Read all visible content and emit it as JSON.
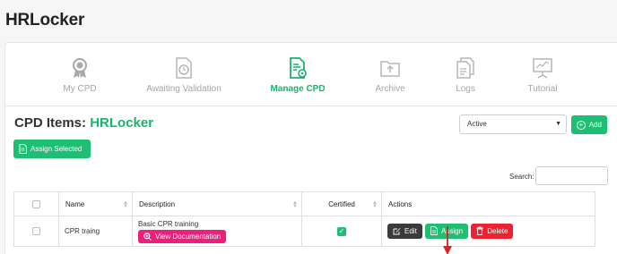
{
  "app": {
    "title": "HRLocker"
  },
  "nav": [
    {
      "label": "My CPD",
      "icon": "medal-icon",
      "active": false
    },
    {
      "label": "Awaiting Validation",
      "icon": "document-clock-icon",
      "active": false
    },
    {
      "label": "Manage CPD",
      "icon": "document-settings-icon",
      "active": true
    },
    {
      "label": "Archive",
      "icon": "archive-folder-icon",
      "active": false
    },
    {
      "label": "Logs",
      "icon": "files-icon",
      "active": false
    },
    {
      "label": "Tutorial",
      "icon": "presentation-board-icon",
      "active": false
    }
  ],
  "section": {
    "title_prefix": "CPD Items:",
    "title_brand": "HRLocker"
  },
  "filter": {
    "selected": "Active"
  },
  "buttons": {
    "add": "Add",
    "assign_selected": "Assign Selected"
  },
  "search": {
    "label": "Search:",
    "value": ""
  },
  "table": {
    "headers": {
      "name": "Name",
      "description": "Description",
      "certified": "Certified",
      "actions": "Actions"
    },
    "rows": [
      {
        "name": "CPR traing",
        "description": "Basic CPR training",
        "view_doc_label": "View Documentation",
        "certified": true,
        "edit_label": "Edit",
        "assign_label": "Assign",
        "delete_label": "Delete"
      }
    ]
  },
  "colors": {
    "brand": "#17b46a",
    "button_green": "#1ebf73",
    "delete_red": "#ee2130",
    "view_doc_pink": "#ed1f7c",
    "annotation_arrow": "#e0201c"
  }
}
